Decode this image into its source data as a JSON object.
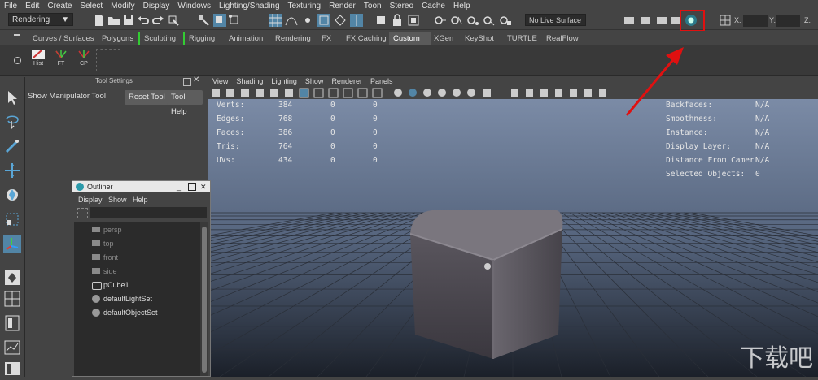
{
  "menubar": [
    "File",
    "Edit",
    "Create",
    "Select",
    "Modify",
    "Display",
    "Windows",
    "Lighting/Shading",
    "Texturing",
    "Render",
    "Toon",
    "Stereo",
    "Cache",
    "Help"
  ],
  "status": {
    "mode": "Rendering",
    "live_surface": "No Live Surface",
    "x_label": "X:",
    "y_label": "Y:",
    "z_label": "Z:"
  },
  "shelf_tabs": [
    "Curves / Surfaces",
    "Polygons",
    "Sculpting",
    "Rigging",
    "Animation",
    "Rendering",
    "FX",
    "FX Caching",
    "Custom",
    "XGen",
    "KeyShot",
    "TURTLE",
    "RealFlow"
  ],
  "active_shelf_tab": "Custom",
  "shelf_buttons": [
    "Hist",
    "FT",
    "CP"
  ],
  "tool_settings": {
    "title": "Tool Settings",
    "tool_name": "Show Manipulator Tool",
    "reset_label": "Reset Tool",
    "help_label": "Tool Help"
  },
  "view_menu": [
    "View",
    "Shading",
    "Lighting",
    "Show",
    "Renderer",
    "Panels"
  ],
  "hud": {
    "left": [
      {
        "label": "Verts:",
        "a": "384",
        "b": "0",
        "c": "0"
      },
      {
        "label": "Edges:",
        "a": "768",
        "b": "0",
        "c": "0"
      },
      {
        "label": "Faces:",
        "a": "386",
        "b": "0",
        "c": "0"
      },
      {
        "label": "Tris:",
        "a": "764",
        "b": "0",
        "c": "0"
      },
      {
        "label": "UVs:",
        "a": "434",
        "b": "0",
        "c": "0"
      }
    ],
    "right": [
      {
        "label": "Backfaces:",
        "value": "N/A"
      },
      {
        "label": "Smoothness:",
        "value": "N/A"
      },
      {
        "label": "Instance:",
        "value": "N/A"
      },
      {
        "label": "Display Layer:",
        "value": "N/A"
      },
      {
        "label": "Distance From Camera:",
        "value": "N/A"
      },
      {
        "label": "Selected Objects:",
        "value": "0"
      }
    ]
  },
  "outliner": {
    "title": "Outliner",
    "menu": [
      "Display",
      "Show",
      "Help"
    ],
    "items": [
      {
        "label": "persp",
        "dim": true,
        "icon": "camera-icon"
      },
      {
        "label": "top",
        "dim": true,
        "icon": "camera-icon"
      },
      {
        "label": "front",
        "dim": true,
        "icon": "camera-icon"
      },
      {
        "label": "side",
        "dim": true,
        "icon": "camera-icon"
      },
      {
        "label": "pCube1",
        "dim": false,
        "icon": "mesh-icon"
      },
      {
        "label": "defaultLightSet",
        "dim": false,
        "icon": "set-icon"
      },
      {
        "label": "defaultObjectSet",
        "dim": false,
        "icon": "set-icon"
      }
    ]
  },
  "watermark": "下载吧",
  "colors": {
    "accent": "#5285a6",
    "highlight_box": "#e01010",
    "arrow": "#e01010"
  }
}
